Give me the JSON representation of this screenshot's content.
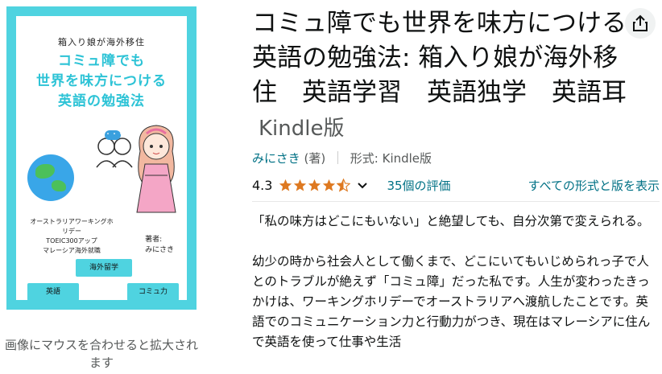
{
  "cover": {
    "subtitle": "箱入り娘が海外移住",
    "title_lines": [
      "コミュ障でも",
      "世界を味方につける",
      "英語の勉強法"
    ],
    "desc_lines": [
      "オーストラリアワーキングホリデー",
      "TOEIC300アップ",
      "マレーシア海外就職"
    ],
    "author_label": "著者:",
    "author_name": "みにさき",
    "tags": [
      "海外留学",
      "英語",
      "コミュ力"
    ],
    "bubble_text": "・・・",
    "colors": {
      "frame": "#4fd3e0",
      "title": "#2dc3d6"
    }
  },
  "hover_hint": "画像にマウスを合わせると拡大されます",
  "product": {
    "title": "コミュ障でも世界を味方につける英語の勉強法: 箱入り娘が海外移住　英語学習　英語独学　英語耳",
    "format_badge": "Kindle版",
    "author": "みにさき",
    "author_role": "(著)",
    "format_label": "形式:",
    "format_value": "Kindle版",
    "rating": "4.3",
    "rating_stars": 4.5,
    "rating_count": "35個の評価",
    "all_formats": "すべての形式と版を表示"
  },
  "share_icon": "share-icon",
  "description": [
    "「私の味方はどこにもいない」と絶望しても、自分次第で変えられる。",
    "幼少の時から社会人として働くまで、どこにいてもいじめられっ子で人とのトラブルが絶えず「コミュ障」だった私です。人生が変わったきっかけは、ワーキングホリデーでオーストラリアへ渡航したことです。英語でのコミュニケーション力と行動力がつき、現在はマレーシアに住んで英語を使って仕事や生活"
  ],
  "colors": {
    "link": "#007185",
    "star": "#de7921",
    "muted": "#565959"
  }
}
